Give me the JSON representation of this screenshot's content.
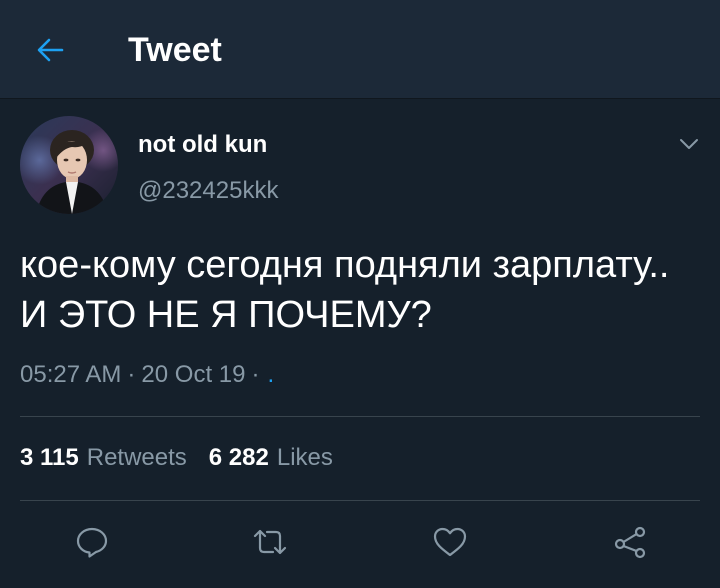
{
  "header": {
    "title": "Tweet",
    "back_icon": "arrow-left-icon"
  },
  "tweet": {
    "display_name": "not old kun",
    "handle": "@232425kkk",
    "text": "кое-кому сегодня подняли зарплату.. И ЭТО НЕ Я ПОЧЕМУ?",
    "time": "05:27 AM",
    "date": "20 Oct 19",
    "meta_separator": "·",
    "app_link": ".",
    "retweets": {
      "count": "3 115",
      "label": "Retweets"
    },
    "likes": {
      "count": "6 282",
      "label": "Likes"
    }
  },
  "actions": [
    {
      "icon": "reply-icon"
    },
    {
      "icon": "retweet-icon"
    },
    {
      "icon": "like-icon"
    },
    {
      "icon": "share-icon"
    }
  ],
  "colors": {
    "background": "#15202b",
    "header_background": "#1c2938",
    "accent": "#1da1f2",
    "muted_text": "#8899a6",
    "divider": "#38444d"
  }
}
